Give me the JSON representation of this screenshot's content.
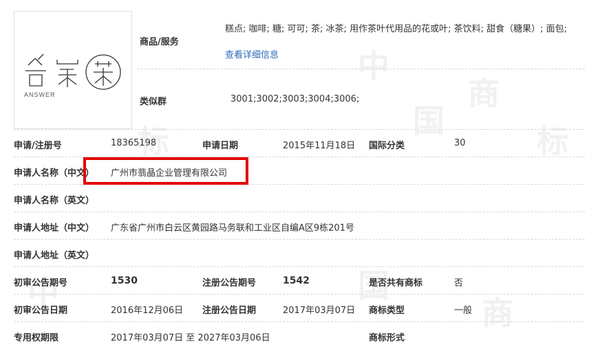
{
  "logo": {
    "brand_text": "ANSWER"
  },
  "goods": {
    "label": "商品/服务",
    "text": "糕点; 咖啡; 糖; 可可; 茶; 冰茶; 用作茶叶代用品的花或叶; 茶饮料; 甜食（糖果）; 面包;",
    "link": "查看详细信息"
  },
  "similar": {
    "label": "类似群",
    "value": "3001;3002;3003;3004;3006;"
  },
  "rows": {
    "reg_no_label": "申请/注册号",
    "reg_no": "18365198",
    "app_date_label": "申请日期",
    "app_date": "2015年11月18日",
    "intl_class_label": "国际分类",
    "intl_class": "30",
    "applicant_cn_label": "申请人名称（中文）",
    "applicant_cn": "广州市翡晶企业管理有限公司",
    "applicant_en_label": "申请人名称（英文）",
    "address_cn_label": "申请人地址（中文）",
    "address_cn": "广东省广州市白云区黄园路马务联和工业区自编A区9栋201号",
    "address_en_label": "申请人地址（英文）",
    "prelim_no_label": "初审公告期号",
    "prelim_no": "1530",
    "reg_pub_no_label": "注册公告期号",
    "reg_pub_no": "1542",
    "shared_label": "是否共有商标",
    "shared": "否",
    "prelim_date_label": "初审公告日期",
    "prelim_date": "2016年12月06日",
    "reg_pub_date_label": "注册公告日期",
    "reg_pub_date": "2017年03月07日",
    "mark_type_label": "商标类型",
    "mark_type": "一般",
    "term_label": "专用权期限",
    "term": "2017年03月07日 至 2027年03月06日",
    "mark_form_label": "商标形式"
  },
  "watermark": {
    "chars": [
      "中",
      "国",
      "商",
      "标",
      "中",
      "国",
      "商",
      "标"
    ]
  },
  "colors": {
    "highlight": "#e30000",
    "link": "#2a6bb6"
  }
}
